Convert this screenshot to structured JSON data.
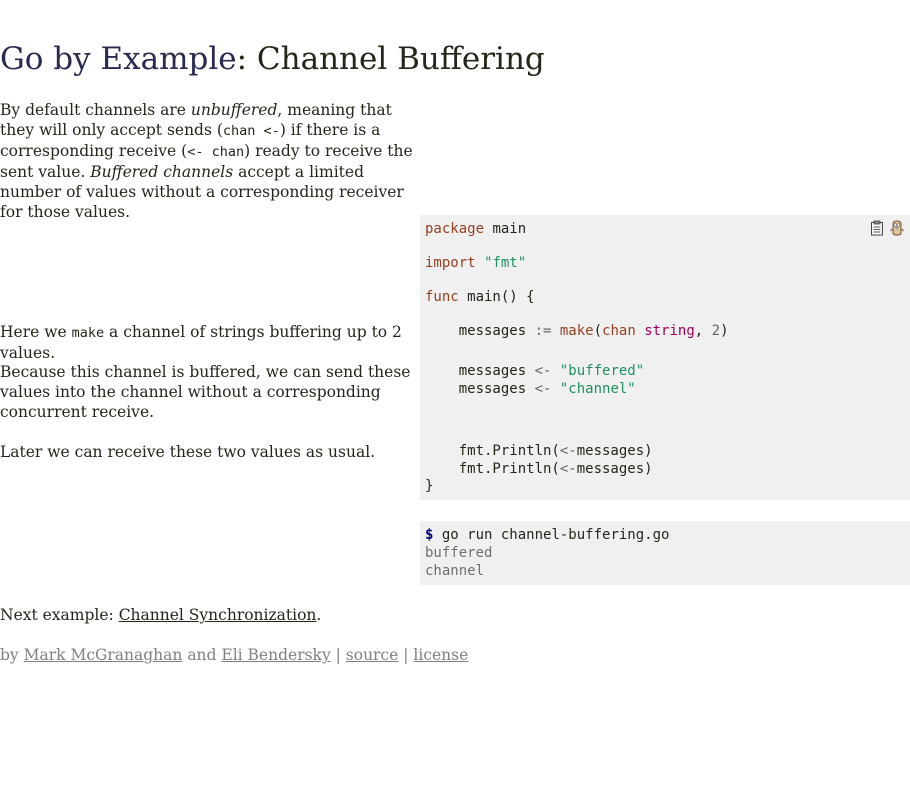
{
  "page": {
    "title_lead": "Go by Example",
    "title_sep": ": ",
    "title_topic": "Channel Buffering"
  },
  "intro": {
    "p1": "By default channels are ",
    "em1": "unbuffered",
    "p2": ", meaning that they will only accept sends (",
    "code1": "chan <-",
    "p3": ") if there is a corresponding receive (",
    "code2": "<- chan",
    "p4": ") ready to receive the sent value. ",
    "em2": "Buffered channels",
    "p5": " accept a limited number of values without a corresponding receiver for those values."
  },
  "notes": {
    "make_pre": "Here we ",
    "make_code": "make",
    "make_post": " a channel of strings buffering up to 2 values.",
    "buffered": "Because this channel is buffered, we can send these values into the channel without a corresponding concurrent receive.",
    "receive": "Later we can receive these two values as usual."
  },
  "code": {
    "package_kw": "package",
    "package_name": " main",
    "import_kw": "import",
    "import_path": "\"fmt\"",
    "func_kw": "func",
    "func_sig": " main() {",
    "make_lhs": "    messages ",
    "make_op": ":=",
    "make_fn": "make",
    "make_open": "(",
    "make_chan": "chan",
    "make_type": "string",
    "make_comma": ", ",
    "make_num": "2",
    "make_close": ")",
    "send_lhs": "    messages ",
    "send_op": "<-",
    "send_val1": "\"buffered\"",
    "send_val2": "\"channel\"",
    "print_pre": "    fmt.Println(",
    "print_op": "<-",
    "print_post": "messages)",
    "close_brace": "}"
  },
  "icons": {
    "copy": "clipboard-icon",
    "run": "gopher-run-icon"
  },
  "shell": {
    "prompt": "$",
    "command": " go run channel-buffering.go",
    "output": [
      "buffered",
      "channel"
    ]
  },
  "footer": {
    "next_prefix": "Next example: ",
    "next_link": "Channel Synchronization",
    "next_suffix": ".",
    "by": "by ",
    "author1": "Mark McGranaghan",
    "and": " and ",
    "author2": "Eli Bendersky",
    "sep1": " | ",
    "source": "source",
    "sep2": " | ",
    "license": "license"
  }
}
